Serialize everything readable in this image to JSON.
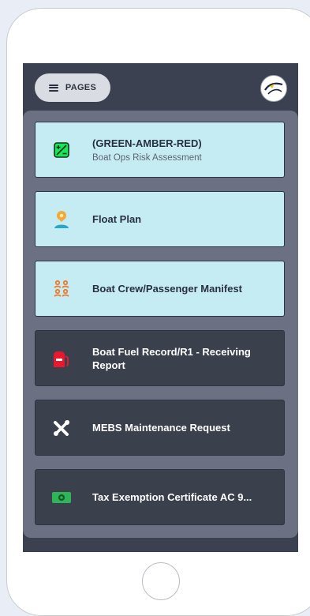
{
  "header": {
    "pages_label": "PAGES"
  },
  "cards": [
    {
      "title": "(GREEN-AMBER-RED)",
      "subtitle": "Boat Ops Risk Assessment",
      "icon": "risk-assessment-icon",
      "theme": "light",
      "icon_color": "#1ee35a"
    },
    {
      "title": "Float Plan",
      "subtitle": "",
      "icon": "location-person-icon",
      "theme": "light",
      "icon_color": "#f2a93b"
    },
    {
      "title": "Boat Crew/Passenger Manifest",
      "subtitle": "",
      "icon": "crew-group-icon",
      "theme": "light",
      "icon_color": "#f07a2a"
    },
    {
      "title": "Boat Fuel Record/R1 - Receiving Report",
      "subtitle": "",
      "icon": "fuel-pump-icon",
      "theme": "dark",
      "icon_color": "#e8192c"
    },
    {
      "title": "MEBS Maintenance Request",
      "subtitle": "",
      "icon": "tools-icon",
      "theme": "dark",
      "icon_color": "#ffffff"
    },
    {
      "title": "Tax Exemption Certificate AC 9...",
      "subtitle": "",
      "icon": "money-icon",
      "theme": "dark",
      "icon_color": "#2fb457"
    }
  ],
  "colors": {
    "screen_bg": "#3b4150",
    "panel_bg": "#6b7183",
    "card_light": "#c5ebf3",
    "card_dark": "#3b404d"
  }
}
